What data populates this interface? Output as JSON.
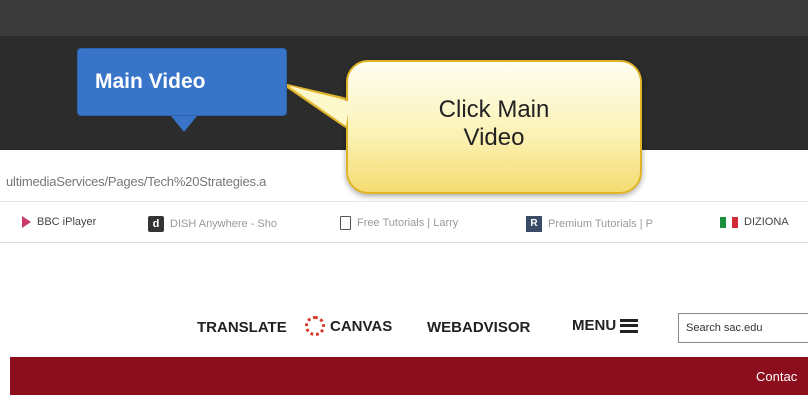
{
  "browser": {
    "url_text": "ultimediaServices/Pages/Tech%20Strategies.a",
    "bookmarks": [
      {
        "label": "BBC iPlayer",
        "icon": "play-icon"
      },
      {
        "label": "DISH Anywhere - Sho",
        "icon": "d-icon"
      },
      {
        "label": "Free Tutorials | Larry",
        "icon": "page-icon"
      },
      {
        "label": "Premium Tutorials | P",
        "icon": "r-icon"
      },
      {
        "label": "DIZIONA",
        "icon": "italian-flag-icon"
      }
    ]
  },
  "site_nav": {
    "translate": "TRANSLATE",
    "canvas": "CANVAS",
    "webadvisor": "WEBADVISOR",
    "menu": "MENU",
    "search_placeholder": "Search sac.edu"
  },
  "banner": {
    "contact_text": "Contac"
  },
  "annotations": {
    "tooltip_label": "Main Video",
    "callout_text": "Click Main\nVideo"
  },
  "colors": {
    "dark_band": "#2c2c2c",
    "tooltip_blue": "#3874c8",
    "callout_yellow": "#fbf2b6",
    "banner_red": "#8c0d1b",
    "canvas_red": "#d83a2a"
  }
}
